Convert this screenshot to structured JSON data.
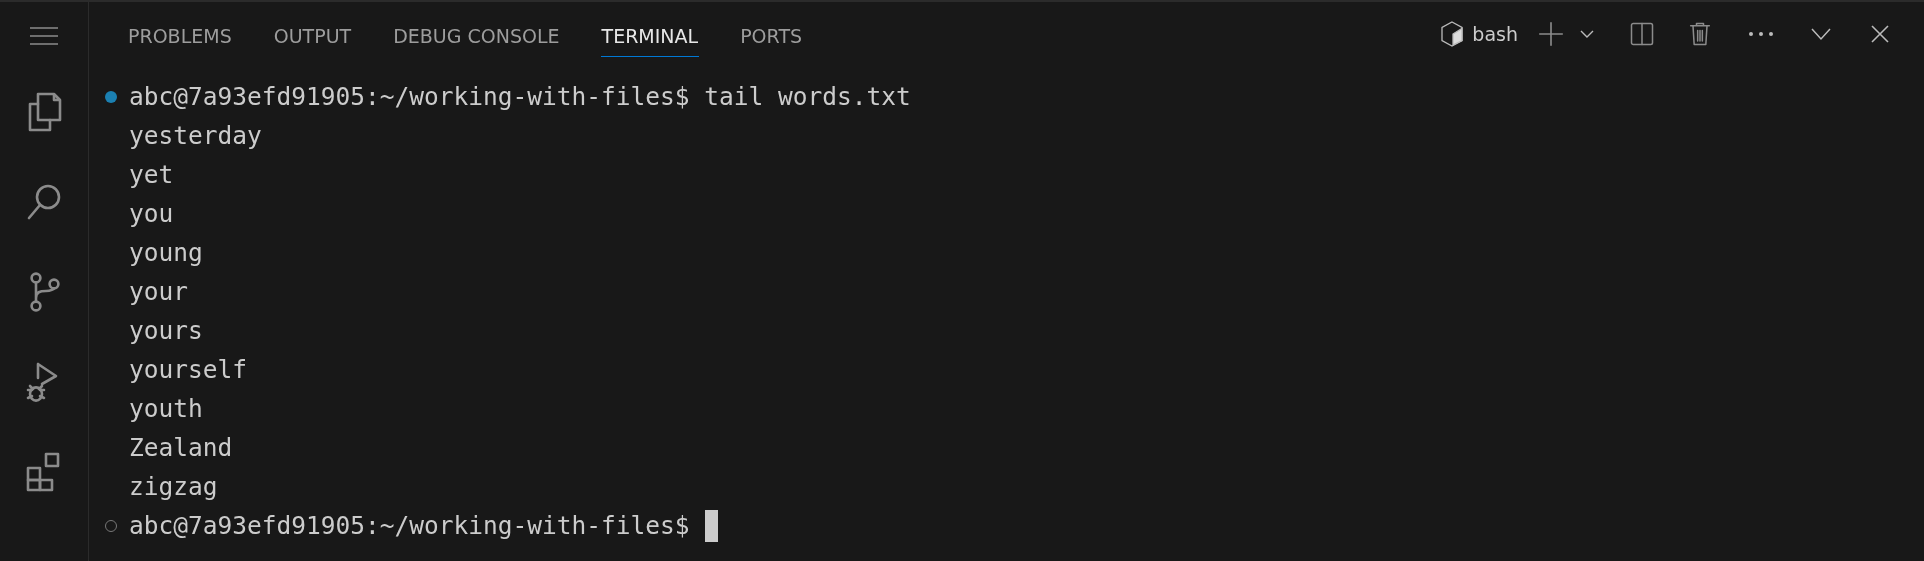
{
  "activity_bar": {
    "items": [
      {
        "kind": "menu"
      },
      {
        "kind": "explorer"
      },
      {
        "kind": "search"
      },
      {
        "kind": "source-control"
      },
      {
        "kind": "run-debug"
      },
      {
        "kind": "extensions"
      }
    ]
  },
  "panel": {
    "tabs": [
      {
        "label": "PROBLEMS",
        "selected": false
      },
      {
        "label": "OUTPUT",
        "selected": false
      },
      {
        "label": "DEBUG CONSOLE",
        "selected": false
      },
      {
        "label": "TERMINAL",
        "selected": true
      },
      {
        "label": "PORTS",
        "selected": false
      }
    ],
    "terminal_name": "bash",
    "terminal_lines": [
      {
        "kind": "command",
        "text": "abc@7a93efd91905:~/working-with-files$ tail words.txt",
        "success": true
      },
      {
        "kind": "output",
        "text": "yesterday"
      },
      {
        "kind": "output",
        "text": "yet"
      },
      {
        "kind": "output",
        "text": "you"
      },
      {
        "kind": "output",
        "text": "young"
      },
      {
        "kind": "output",
        "text": "your"
      },
      {
        "kind": "output",
        "text": "yours"
      },
      {
        "kind": "output",
        "text": "yourself"
      },
      {
        "kind": "output",
        "text": "youth"
      },
      {
        "kind": "output",
        "text": "Zealand"
      },
      {
        "kind": "output",
        "text": "zigzag"
      },
      {
        "kind": "command",
        "text": "abc@7a93efd91905:~/working-with-files$",
        "success": false,
        "cursor": true
      }
    ]
  }
}
